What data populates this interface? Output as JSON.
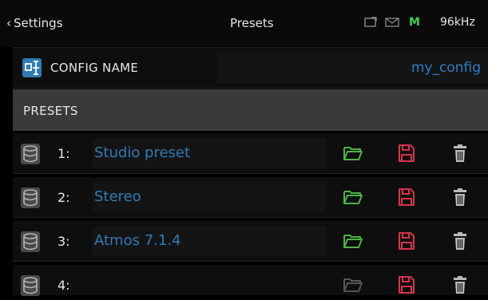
{
  "topbar": {
    "back_label": "Settings",
    "title": "Presets",
    "status_mark": "M",
    "sample_rate": "96kHz"
  },
  "config": {
    "label": "CONFIG NAME",
    "value": "my_config"
  },
  "presets_header": "PRESETS",
  "presets": [
    {
      "num": "1:",
      "name": "Studio preset"
    },
    {
      "num": "2:",
      "name": "Stereo"
    },
    {
      "num": "3:",
      "name": "Atmos 7.1.4"
    },
    {
      "num": "4:",
      "name": ""
    }
  ],
  "colors": {
    "accent_blue": "#2f7bb6",
    "load_green": "#4fb443",
    "save_red": "#d9334a",
    "status_green": "#3fd04a"
  },
  "icons": {
    "back": "chevron-left-icon",
    "screen": "screen-icon",
    "mail": "mail-icon",
    "config": "config-icon",
    "preset": "database-icon",
    "load": "folder-open-icon",
    "save": "save-icon",
    "delete": "trash-icon"
  }
}
